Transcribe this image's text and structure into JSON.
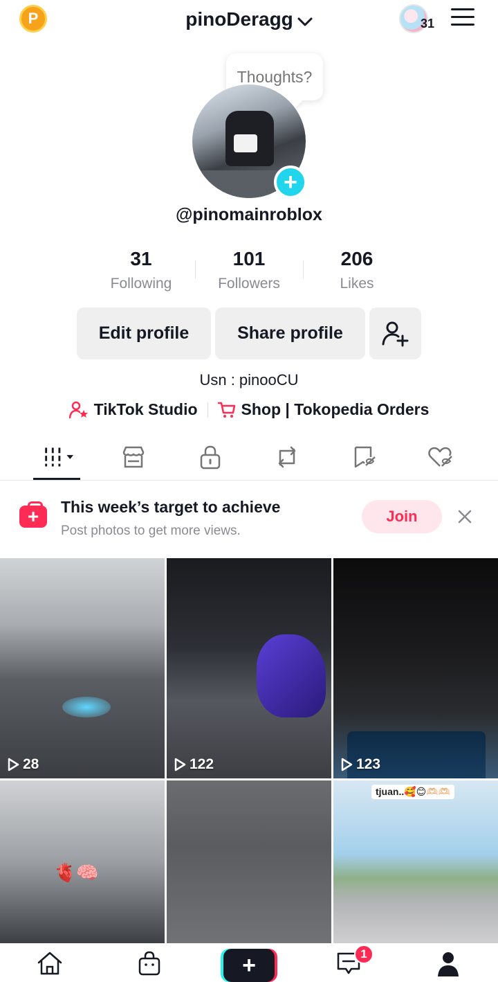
{
  "header": {
    "coin_label": "P",
    "username": "pinoDeragg",
    "friends_count": "31"
  },
  "profile": {
    "thought_bubble": "Thoughts?",
    "handle": "@pinomainroblox",
    "stats": [
      {
        "value": "31",
        "label": "Following"
      },
      {
        "value": "101",
        "label": "Followers"
      },
      {
        "value": "206",
        "label": "Likes"
      }
    ],
    "buttons": {
      "edit": "Edit profile",
      "share": "Share profile"
    },
    "bio": "Usn : pinooCU",
    "links": {
      "studio": "TikTok Studio",
      "shop": "Shop | Tokopedia Orders"
    }
  },
  "tabs": [
    "videos-grid-icon",
    "shop-icon",
    "lock-icon",
    "repost-icon",
    "favorites-icon",
    "liked-icon"
  ],
  "banner": {
    "title": "This week’s target to achieve",
    "subtitle": "Post photos to get more views.",
    "join_label": "Join"
  },
  "videos": [
    {
      "views": "28"
    },
    {
      "views": "122"
    },
    {
      "views": "123"
    },
    {
      "views": ""
    },
    {
      "views": ""
    },
    {
      "views": ""
    }
  ],
  "video_overlays": {
    "tag_text": "tjuan..🥰😊🫶🏻🫶🏻",
    "emoji": "🫀🧠"
  },
  "bottom_nav": {
    "inbox_badge": "1"
  },
  "colors": {
    "accent": "#fe2c55",
    "teal": "#20d5ec",
    "text": "#161823",
    "muted": "#8a8b91"
  }
}
